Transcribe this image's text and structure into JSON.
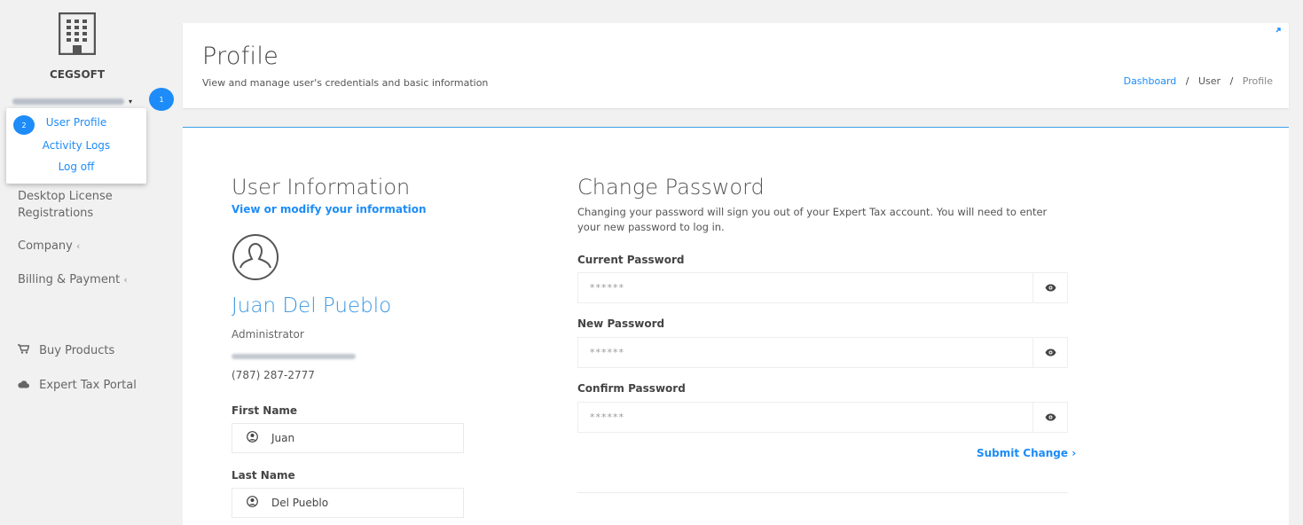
{
  "sidebar": {
    "brand": "CEGSOFT",
    "user_email_hidden": true,
    "caret": "▾",
    "step_badge": "1",
    "dropdown": {
      "step_badge": "2",
      "items": [
        {
          "label": "User Profile"
        },
        {
          "label": "Activity Logs"
        },
        {
          "label": "Log off"
        }
      ]
    },
    "nav": {
      "desktop_license_line1": "Desktop License",
      "desktop_license_line2": "Registrations",
      "company": "Company",
      "billing": "Billing & Payment",
      "chevron": "‹",
      "buy_products": "Buy Products",
      "expert_tax_portal": "Expert Tax Portal"
    }
  },
  "header": {
    "title": "Profile",
    "subtitle": "View and manage user's credentials and basic information",
    "breadcrumb": {
      "dashboard": "Dashboard",
      "sep": "/",
      "user": "User",
      "profile": "Profile"
    }
  },
  "user_info": {
    "title": "User Information",
    "link": "View or modify your information",
    "name": "Juan Del Pueblo",
    "role": "Administrator",
    "phone": "(787) 287-2777",
    "first_name_label": "First Name",
    "first_name_value": "Juan",
    "last_name_label": "Last Name",
    "last_name_value": "Del Pueblo"
  },
  "change_password": {
    "title": "Change Password",
    "description": "Changing your password will sign you out of your Expert Tax account. You will need to enter your new password to log in.",
    "current_label": "Current Password",
    "current_placeholder": "******",
    "new_label": "New Password",
    "new_placeholder": "******",
    "confirm_label": "Confirm Password",
    "confirm_placeholder": "******",
    "submit_label": "Submit Change ›"
  },
  "colors": {
    "accent": "#1d8cf8",
    "name_blue": "#3a97e3",
    "background": "#f1f1f1"
  },
  "icons": [
    "building-icon",
    "caret-down-icon",
    "shopping-cart-icon",
    "cloud-icon",
    "user-circle-icon",
    "eye-icon",
    "expand-icon"
  ]
}
